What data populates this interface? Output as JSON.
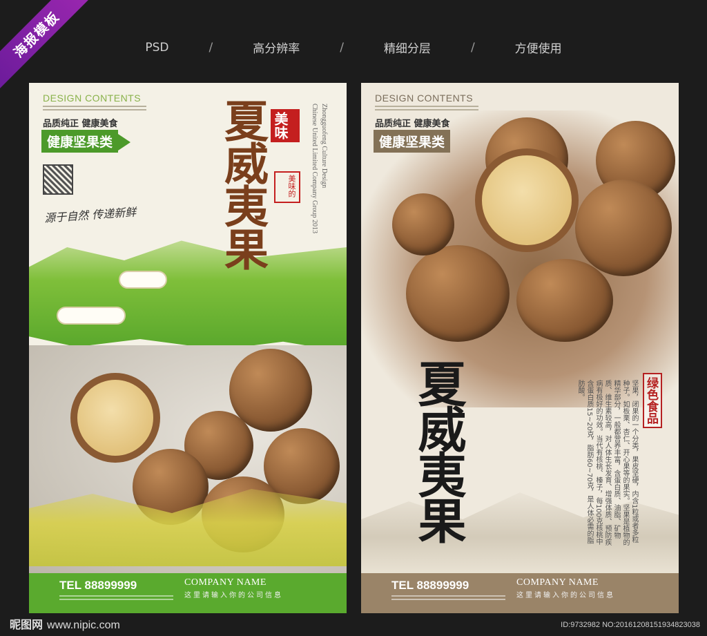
{
  "ribbon": "海报模板",
  "top_bar": [
    "PSD",
    "高分辨率",
    "精细分层",
    "方便使用"
  ],
  "top_bar_sep": "/",
  "left": {
    "design_contents": "DESIGN CONTENTS",
    "tagline": "品质纯正 健康美食",
    "category": "健康坚果类",
    "title": "夏威夷果",
    "meiwei": "美味",
    "seal": "美味的",
    "company_vertical": "Zhongguofeng Culture Design",
    "company_vertical_2": "Chinese United Limited Company Group 2013",
    "handwriting": "源于自然 传递新鲜",
    "tel": "TEL 88899999",
    "company_name": "COMPANY NAME",
    "company_sub": "这里请输入你的公司信息"
  },
  "right": {
    "design_contents": "DESIGN CONTENTS",
    "tagline": "品质纯正 健康美食",
    "category": "健康坚果类",
    "title": "夏威夷果",
    "green_food": "绿色食品",
    "body_text": "坚果，闭果的一个分类，果皮坚硬，内含1粒或者多粒种子。如板栗、杏仁、开心果等的果实。坚果是植物的精华部分，一般都营养丰富，含蛋白质、油脂、矿物质、维生素较高，对人体生长发育、增强体质、预防疾病有极好的功效。当代有核桃、榛子，每100克核桃中含蛋白质15~20克，脂肪60~70克，是人体必需的脂肪酸。",
    "tel": "TEL 88899999",
    "company_name": "COMPANY NAME",
    "company_sub": "这里请输入你的公司信息"
  },
  "watermark_site": "昵图网",
  "watermark_url": "www.nipic.com",
  "watermark_id": "ID:9732982 NO:20161208151934823038"
}
